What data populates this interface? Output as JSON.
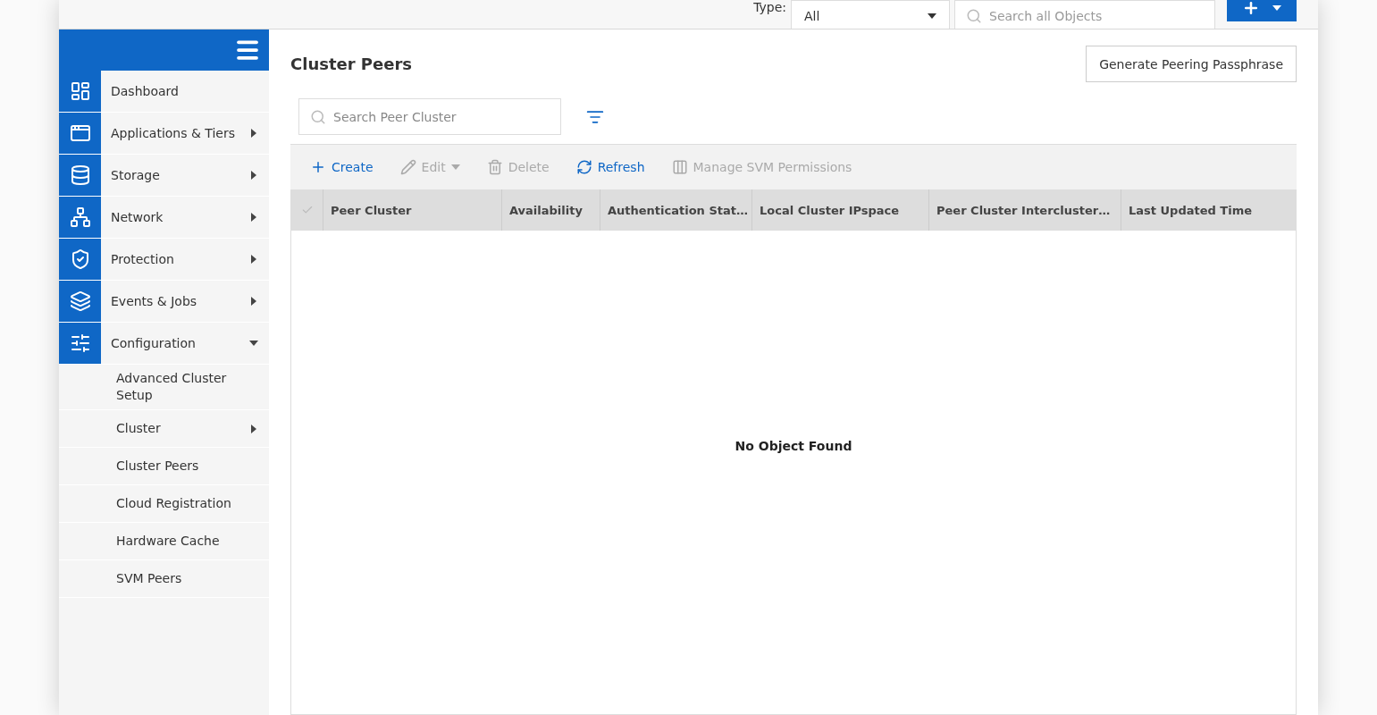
{
  "top_bar": {
    "type_label": "Type:",
    "type_select": "All",
    "search": {
      "placeholder": "Search all Objects"
    }
  },
  "sidebar": {
    "items": [
      {
        "label": "Dashboard"
      },
      {
        "label": "Applications & Tiers",
        "expanded": false
      },
      {
        "label": "Storage",
        "expanded": false
      },
      {
        "label": "Network",
        "expanded": false
      },
      {
        "label": "Protection",
        "expanded": false
      },
      {
        "label": "Events & Jobs",
        "expanded": false
      },
      {
        "label": "Configuration",
        "expanded": true
      }
    ],
    "sub_items": [
      {
        "label": "Advanced Cluster Setup",
        "has_submenu": false
      },
      {
        "label": "Cluster",
        "has_submenu": true
      },
      {
        "label": "Cluster Peers",
        "has_submenu": false
      },
      {
        "label": "Cloud Registration",
        "has_submenu": false
      },
      {
        "label": "Hardware Cache",
        "has_submenu": false
      },
      {
        "label": "SVM Peers",
        "has_submenu": false
      }
    ]
  },
  "page": {
    "title": "Cluster Peers",
    "action_button": "Generate Peering Passphrase",
    "search": {
      "placeholder": "Search Peer Cluster"
    }
  },
  "toolbar": [
    {
      "label": "Create",
      "disabled": false
    },
    {
      "label": "Edit",
      "disabled": true,
      "dropdown": true
    },
    {
      "label": "Delete",
      "disabled": true
    },
    {
      "label": "Refresh",
      "disabled": false
    },
    {
      "label": "Manage SVM Permissions",
      "disabled": true
    }
  ],
  "table": {
    "select_all": {
      "disabled": true
    },
    "columns": [
      "Peer Cluster",
      "Availability",
      "Authentication Stat…",
      "Local Cluster IPspace",
      "Peer Cluster Intercluster…",
      "Last Updated Time"
    ],
    "empty_message": "No Object Found"
  }
}
